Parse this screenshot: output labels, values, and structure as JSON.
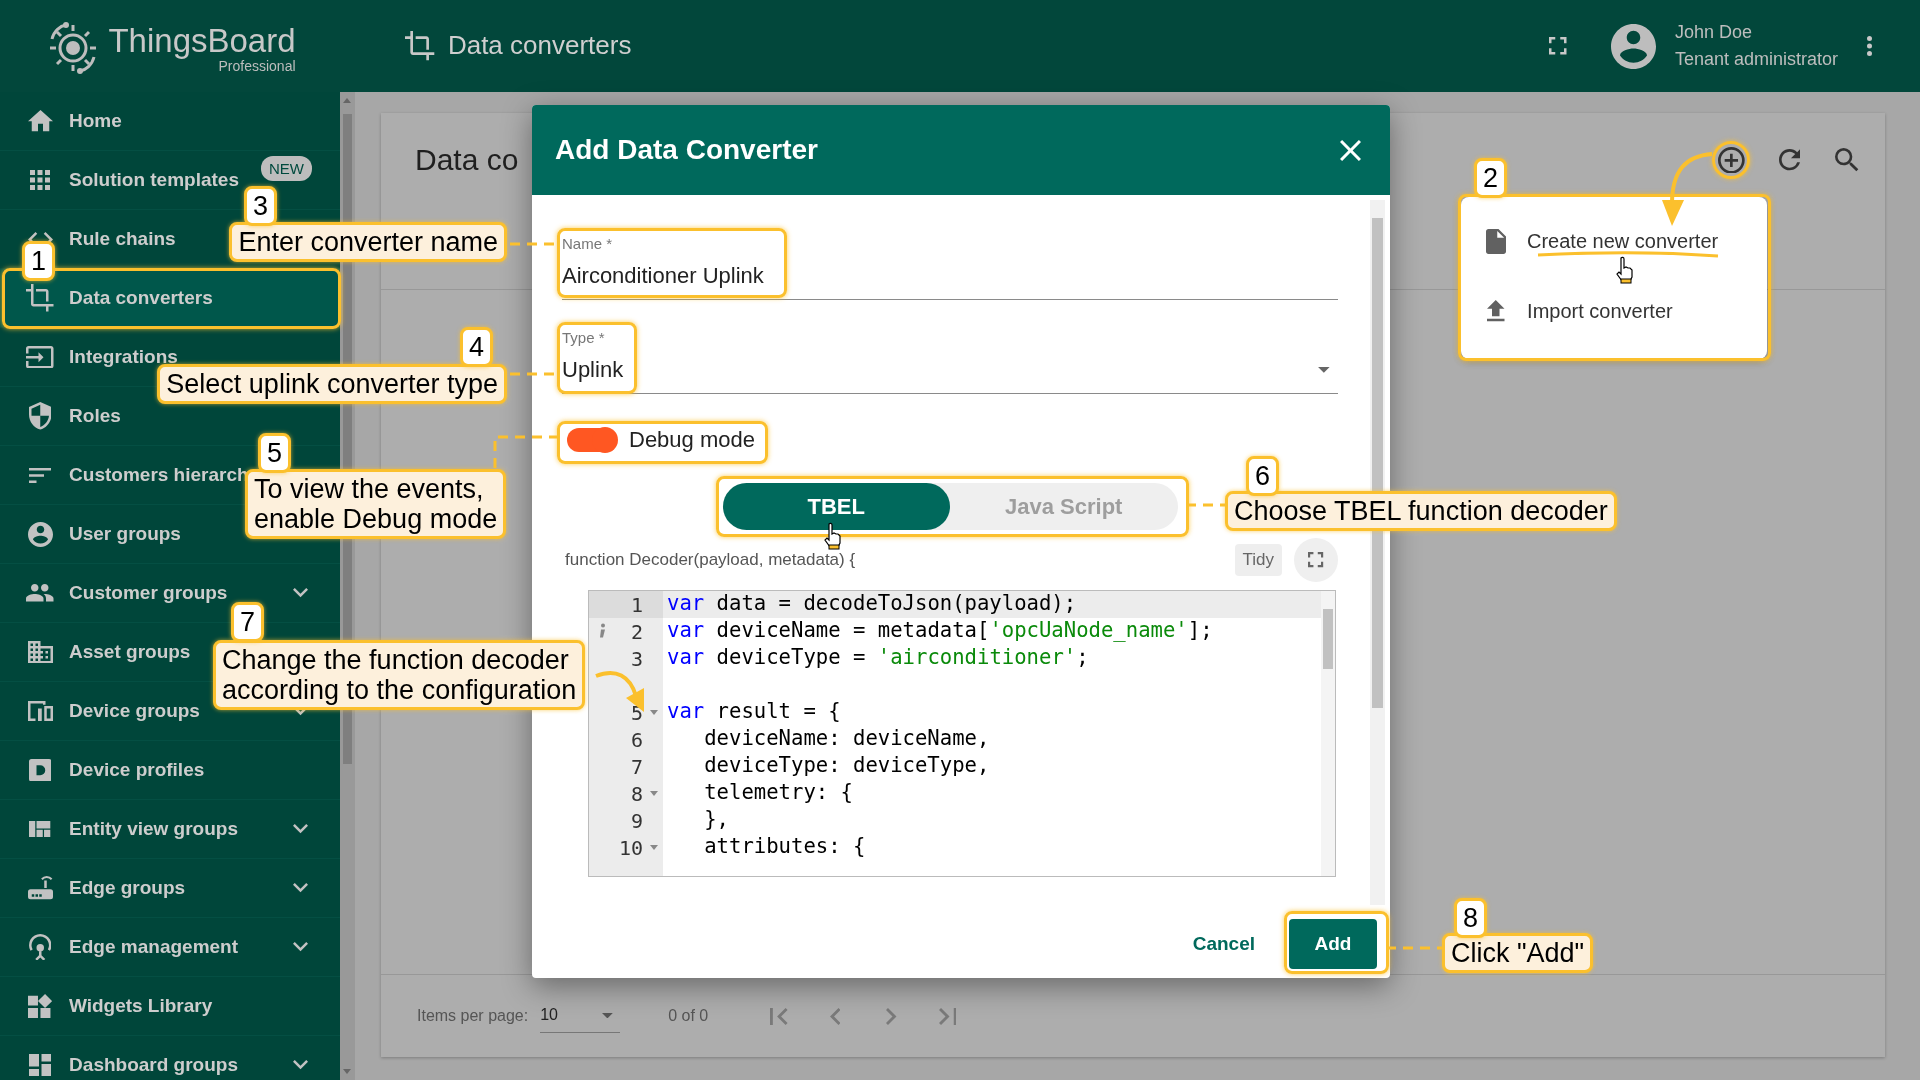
{
  "app": {
    "logo": "ThingsBoard",
    "edition": "Professional"
  },
  "top_bar": {
    "title": "Data converters",
    "user_name": "John Doe",
    "user_role": "Tenant administrator"
  },
  "sidebar": {
    "items": [
      {
        "label": "Home",
        "selected": false,
        "expandable": false
      },
      {
        "label": "Solution templates",
        "selected": false,
        "expandable": false,
        "badge": "NEW"
      },
      {
        "label": "Rule chains",
        "selected": false,
        "expandable": false
      },
      {
        "label": "Data converters",
        "selected": true,
        "expandable": false
      },
      {
        "label": "Integrations",
        "selected": false,
        "expandable": false
      },
      {
        "label": "Roles",
        "selected": false,
        "expandable": false
      },
      {
        "label": "Customers hierarch",
        "selected": false,
        "expandable": false
      },
      {
        "label": "User groups",
        "selected": false,
        "expandable": false
      },
      {
        "label": "Customer groups",
        "selected": false,
        "expandable": true
      },
      {
        "label": "Asset groups",
        "selected": false,
        "expandable": false
      },
      {
        "label": "Device groups",
        "selected": false,
        "expandable": true
      },
      {
        "label": "Device profiles",
        "selected": false,
        "expandable": false
      },
      {
        "label": "Entity view groups",
        "selected": false,
        "expandable": true
      },
      {
        "label": "Edge groups",
        "selected": false,
        "expandable": true
      },
      {
        "label": "Edge management",
        "selected": false,
        "expandable": true
      },
      {
        "label": "Widgets Library",
        "selected": false,
        "expandable": false
      },
      {
        "label": "Dashboard groups",
        "selected": false,
        "expandable": true
      }
    ]
  },
  "card": {
    "title": "Data co",
    "pagination": {
      "label": "Items per page:",
      "page_size": "10",
      "range": "0 of 0"
    }
  },
  "add_menu": {
    "items": [
      {
        "label": "Create new converter"
      },
      {
        "label": "Import converter"
      }
    ]
  },
  "dialog": {
    "title": "Add Data Converter",
    "fields": [
      {
        "label": "Name *",
        "value": "Airconditioner Uplink",
        "kind": "text"
      },
      {
        "label": "Type *",
        "value": "Uplink",
        "kind": "select"
      }
    ],
    "debug": {
      "label": "Debug mode",
      "on": true
    },
    "language_tabs": [
      {
        "label": "TBEL",
        "selected": true
      },
      {
        "label": "Java Script",
        "selected": false
      }
    ],
    "function_header": "function Decoder(payload, metadata) {",
    "tidy": "Tidy",
    "code_lines": [
      {
        "kind": "code",
        "number": "1",
        "active": true,
        "fold": false,
        "info": false,
        "segments": [
          {
            "kind": "keyword",
            "text": "var"
          },
          {
            "kind": "plain",
            "text": " data = decodeToJson(payload);"
          }
        ]
      },
      {
        "kind": "code",
        "number": "2",
        "active": false,
        "fold": false,
        "info": true,
        "segments": [
          {
            "kind": "keyword",
            "text": "var"
          },
          {
            "kind": "plain",
            "text": " deviceName = metadata["
          },
          {
            "kind": "string",
            "text": "'opcUaNode_name'"
          },
          {
            "kind": "plain",
            "text": "];"
          }
        ]
      },
      {
        "kind": "code",
        "number": "3",
        "active": false,
        "fold": false,
        "info": false,
        "segments": [
          {
            "kind": "keyword",
            "text": "var"
          },
          {
            "kind": "plain",
            "text": " deviceType = "
          },
          {
            "kind": "string",
            "text": "'airconditioner'"
          },
          {
            "kind": "plain",
            "text": ";"
          }
        ]
      },
      {
        "kind": "blank"
      },
      {
        "kind": "code",
        "number": "5",
        "active": false,
        "fold": true,
        "info": false,
        "segments": [
          {
            "kind": "keyword",
            "text": "var"
          },
          {
            "kind": "plain",
            "text": " result = {"
          }
        ]
      },
      {
        "kind": "code",
        "number": "6",
        "active": false,
        "fold": false,
        "info": false,
        "segments": [
          {
            "kind": "plain",
            "text": "   deviceName: deviceName,"
          }
        ]
      },
      {
        "kind": "code",
        "number": "7",
        "active": false,
        "fold": false,
        "info": false,
        "segments": [
          {
            "kind": "plain",
            "text": "   deviceType: deviceType,"
          }
        ]
      },
      {
        "kind": "code",
        "number": "8",
        "active": false,
        "fold": true,
        "info": false,
        "segments": [
          {
            "kind": "plain",
            "text": "   telemetry: {"
          }
        ]
      },
      {
        "kind": "code",
        "number": "9",
        "active": false,
        "fold": false,
        "info": false,
        "segments": [
          {
            "kind": "plain",
            "text": "   },"
          }
        ]
      },
      {
        "kind": "code",
        "number": "10",
        "active": false,
        "fold": true,
        "info": false,
        "segments": [
          {
            "kind": "plain",
            "text": "   attributes: {"
          }
        ]
      }
    ],
    "buttons": [
      {
        "label": "Cancel",
        "kind": "text"
      },
      {
        "label": "Add",
        "kind": "primary"
      }
    ]
  },
  "annotations": [
    {
      "number": "1"
    },
    {
      "number": "2"
    },
    {
      "number": "3",
      "text": "Enter converter name"
    },
    {
      "number": "4",
      "text": "Select uplink converter type"
    },
    {
      "number": "5",
      "text": "To view the events,\nenable Debug mode"
    },
    {
      "number": "6",
      "text": "Choose TBEL function decoder"
    },
    {
      "number": "7",
      "text": "Change the function decoder\naccording to the configuration"
    },
    {
      "number": "8",
      "text": "Click \"Add\""
    }
  ]
}
